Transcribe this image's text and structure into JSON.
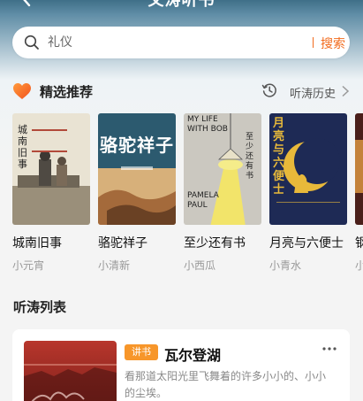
{
  "header": {
    "title": "文涛听书"
  },
  "search": {
    "placeholder": "礼仪",
    "button_label": "搜索"
  },
  "recommend": {
    "title": "精选推荐",
    "history_label": "听涛历史"
  },
  "books": [
    {
      "title": "城南旧事",
      "reader": "小元宵",
      "cover_text": "城南旧事"
    },
    {
      "title": "骆驼祥子",
      "reader": "小清新",
      "cover_text": "骆驼祥子"
    },
    {
      "title": "至少还有书",
      "reader": "小西瓜",
      "cover_text_1": "MY LIFE",
      "cover_text_2": "WITH BOB",
      "cover_text_3": "PAMELA",
      "cover_text_4": "PAUL",
      "cover_text_5": "至少还有书"
    },
    {
      "title": "月亮与六便士",
      "reader": "小青水",
      "cover_text": "月亮与六便士"
    },
    {
      "title": "钢",
      "reader": "小"
    }
  ],
  "list": {
    "title": "听涛列表",
    "items": [
      {
        "tag": "讲书",
        "title": "瓦尔登湖",
        "desc": "看那道太阳光里飞舞着的许多小小的、小小的尘埃。"
      }
    ]
  },
  "colors": {
    "accent": "#f26b1d",
    "tag": "#f7962a",
    "header": "#4a7a93"
  }
}
